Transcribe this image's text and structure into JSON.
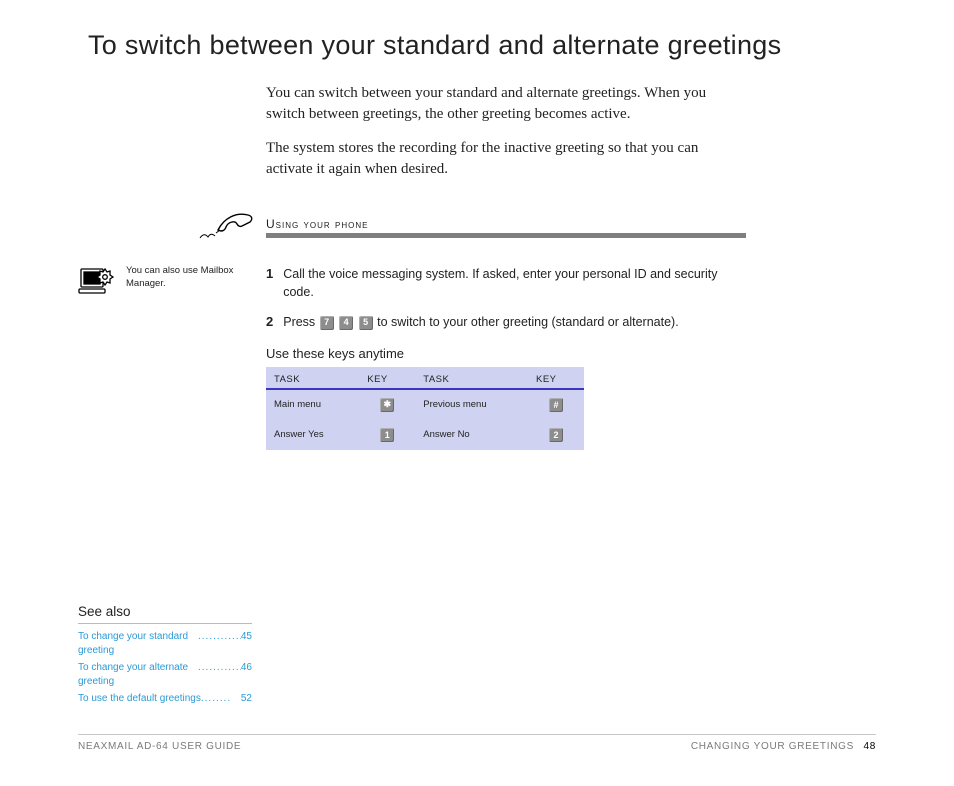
{
  "title": "To switch between your standard and alternate greetings",
  "intro": {
    "p1": "You can switch between your standard and alternate greetings. When you switch between greetings, the other greeting becomes active.",
    "p2": "The system stores the recording for the inactive greeting so that you can activate it again when desired."
  },
  "section_label": "Using your phone",
  "mailbox_note": "You can also use Mailbox Manager.",
  "steps": [
    {
      "num": "1",
      "text": "Call the voice messaging system. If asked, enter your personal ID and security code."
    },
    {
      "num": "2",
      "pre": "Press ",
      "keys": [
        "7",
        "4",
        "5"
      ],
      "post": " to switch to your other greeting (standard or alternate)."
    }
  ],
  "anytime_heading": "Use these keys anytime",
  "key_table": {
    "headers": [
      "TASK",
      "KEY",
      "TASK",
      "KEY"
    ],
    "rows": [
      {
        "t1": "Main menu",
        "k1": "✱",
        "t2": "Previous menu",
        "k2": "#"
      },
      {
        "t1": "Answer Yes",
        "k1": "1",
        "t2": "Answer No",
        "k2": "2"
      }
    ]
  },
  "see_also": {
    "heading": "See also",
    "items": [
      {
        "label": "To change your standard greeting",
        "page": "45"
      },
      {
        "label": "To change your alternate greeting",
        "page": "46"
      },
      {
        "label": "To use the default greetings",
        "page": "52"
      }
    ]
  },
  "footer": {
    "left": "NEAXMAIL AD-64 USER GUIDE",
    "right": "CHANGING YOUR GREETINGS",
    "page": "48"
  }
}
